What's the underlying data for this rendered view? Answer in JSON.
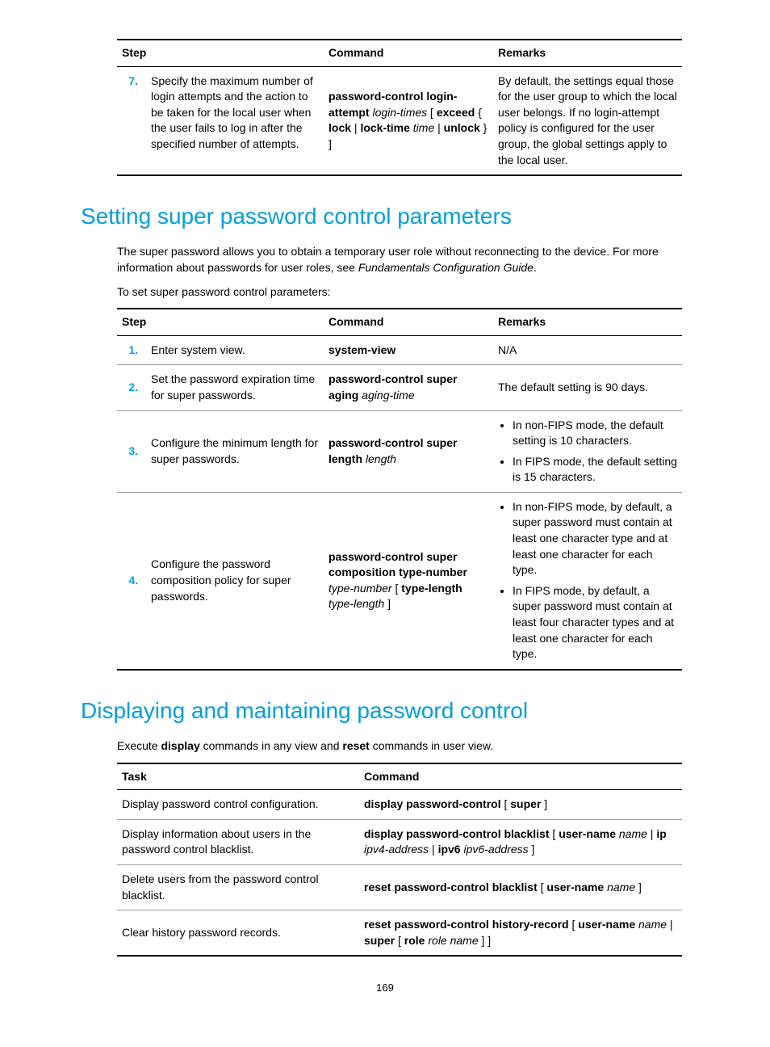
{
  "table1": {
    "headers": {
      "step": "Step",
      "command": "Command",
      "remarks": "Remarks"
    },
    "row": {
      "num": "7.",
      "desc": "Specify the maximum number of login attempts and the action to be taken for the local user when the user fails to log in after the specified number of attempts.",
      "remarks": "By default, the settings equal those for the user group to which the local user belongs. If no login-attempt policy is configured for the user group, the global settings apply to the local user."
    }
  },
  "h1a": "Setting super password control parameters",
  "p1": "The super password allows you to obtain a temporary user role without reconnecting to the device. For more information about passwords for user roles, see ",
  "p1i": "Fundamentals Configuration Guide",
  "p1end": ".",
  "p2": "To set super password control parameters:",
  "table2": {
    "headers": {
      "step": "Step",
      "command": "Command",
      "remarks": "Remarks"
    },
    "rows": [
      {
        "num": "1.",
        "desc": "Enter system view.",
        "cmd": "system-view",
        "remarks": "N/A"
      },
      {
        "num": "2.",
        "desc": "Set the password expiration time for super passwords.",
        "remarks": "The default setting is 90 days."
      },
      {
        "num": "3.",
        "desc": "Configure the minimum length for super passwords.",
        "b1": "In non-FIPS mode, the default setting is 10 characters.",
        "b2": "In FIPS mode, the default setting is 15 characters."
      },
      {
        "num": "4.",
        "desc": "Configure the password composition policy for super passwords.",
        "b1": "In non-FIPS mode, by default, a super password must contain at least one character type and at least one character for each type.",
        "b2": "In FIPS mode, by default, a super password must contain at least four character types and at least one character for each type."
      }
    ]
  },
  "h1b": "Displaying and maintaining password control",
  "p3a": "Execute ",
  "p3b": "display",
  "p3c": " commands in any view and ",
  "p3d": "reset",
  "p3e": " commands in user view.",
  "table3": {
    "headers": {
      "task": "Task",
      "command": "Command"
    },
    "rows": [
      {
        "task": "Display password control configuration."
      },
      {
        "task": "Display information about users in the password control blacklist."
      },
      {
        "task": "Delete users from the password control blacklist."
      },
      {
        "task": "Clear history password records."
      }
    ]
  },
  "pagenum": "169"
}
